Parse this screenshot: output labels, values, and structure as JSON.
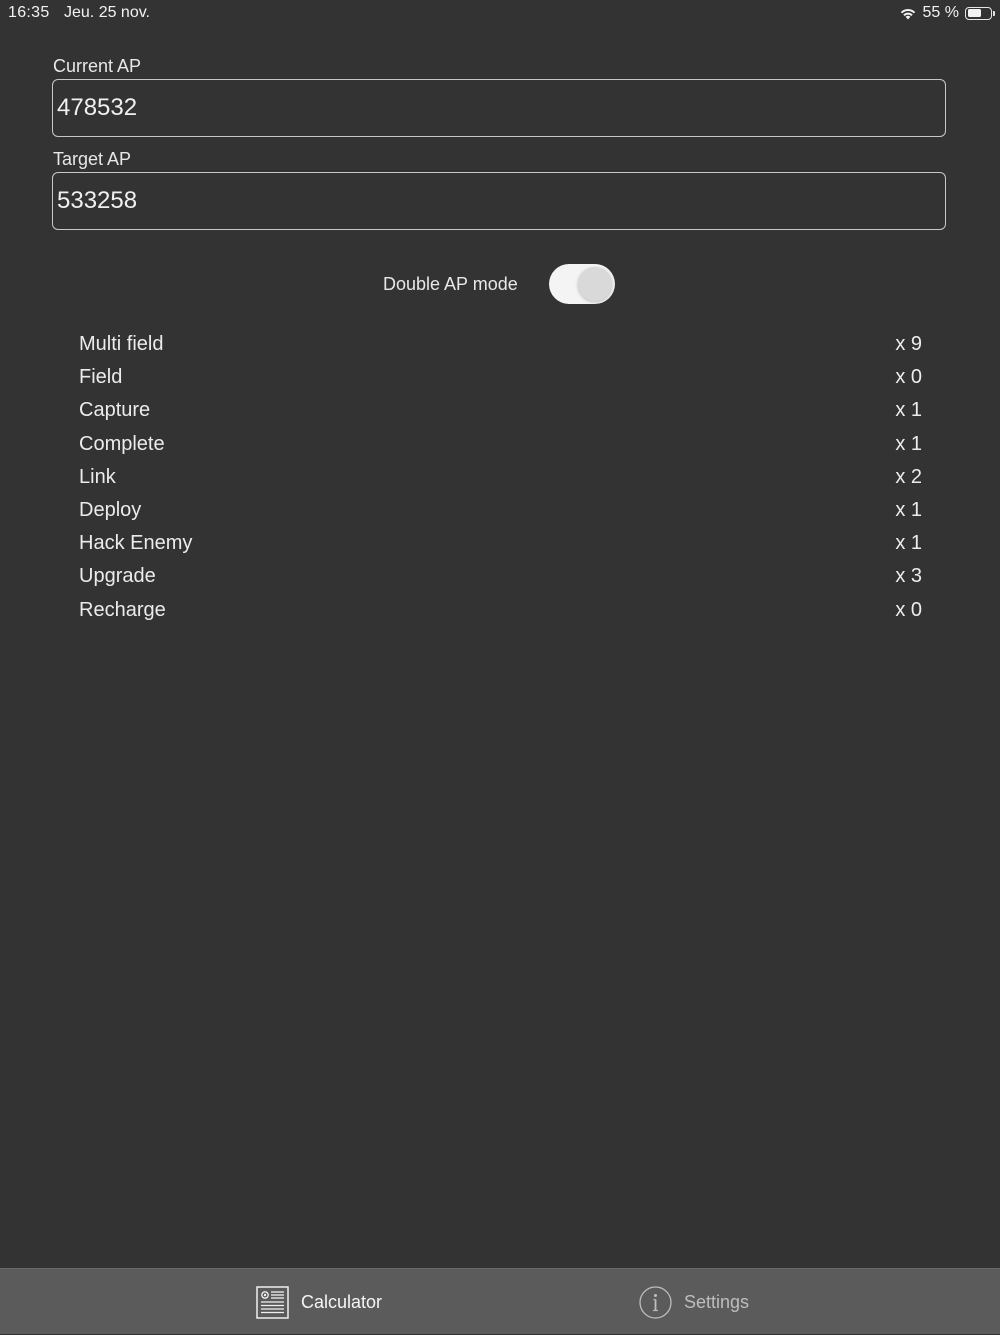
{
  "status_bar": {
    "time": "16:35",
    "date": "Jeu. 25 nov.",
    "battery": "55 %",
    "icons": [
      "wifi-icon",
      "battery-icon"
    ]
  },
  "form": {
    "current_ap": {
      "label": "Current AP",
      "value": "478532"
    },
    "target_ap": {
      "label": "Target AP",
      "value": "533258"
    },
    "double_ap_mode": {
      "label": "Double AP mode",
      "enabled": true
    }
  },
  "actions": [
    {
      "name": "Multi field",
      "count": "x 9"
    },
    {
      "name": "Field",
      "count": "x 0"
    },
    {
      "name": "Capture",
      "count": "x 1"
    },
    {
      "name": "Complete",
      "count": "x 1"
    },
    {
      "name": "Link",
      "count": "x 2"
    },
    {
      "name": "Deploy",
      "count": "x 1"
    },
    {
      "name": "Hack Enemy",
      "count": "x 1"
    },
    {
      "name": "Upgrade",
      "count": "x 3"
    },
    {
      "name": "Recharge",
      "count": "x 0"
    }
  ],
  "tab_bar": {
    "tabs": [
      {
        "label": "Calculator",
        "icon": "calculator-icon",
        "selected": true
      },
      {
        "label": "Settings",
        "icon": "info-icon",
        "selected": false
      }
    ]
  },
  "colors": {
    "background": "#333333",
    "tab_bar": "#5b5b5b",
    "text": "#ececec",
    "toggle_track": "#f4f4f4"
  }
}
